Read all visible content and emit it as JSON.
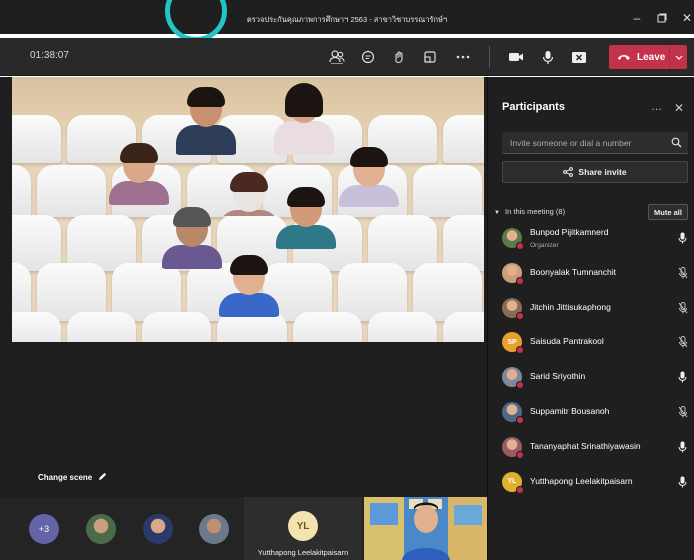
{
  "window": {
    "title": "ตรวจประกันคุณภาพการศึกษาฯ 2563 - สาขาวิชาบรรณารักษ์ฯ"
  },
  "toolbar": {
    "timer": "01:38:07",
    "leave_label": "Leave"
  },
  "stage": {
    "change_scene_label": "Change scene"
  },
  "strip": {
    "overflow_count": "+3",
    "tile_initials": "YL",
    "tile_name": "Yutthapong Leelakitpaisarn"
  },
  "panel": {
    "title": "Participants",
    "invite_placeholder": "Invite someone or dial a number",
    "share_invite_label": "Share invite",
    "section_label": "In this meeting (8)",
    "mute_all_label": "Mute all",
    "participants": [
      {
        "name": "Bunpod Pijitkamnerd",
        "role": "Organizer",
        "mic": "on",
        "avatar": "photo",
        "color": "#5a7a4a"
      },
      {
        "name": "Boonyalak Tumnanchit",
        "role": "",
        "mic": "off",
        "avatar": "photo",
        "color": "#c9a07a"
      },
      {
        "name": "Jitchin Jittisukaphong",
        "role": "",
        "mic": "off",
        "avatar": "photo",
        "color": "#8a6a50"
      },
      {
        "name": "Saisuda Pantrakool",
        "role": "",
        "mic": "off",
        "avatar": "initials",
        "initials": "SP",
        "color": "#e8a030"
      },
      {
        "name": "Sarid Sriyothin",
        "role": "",
        "mic": "on",
        "avatar": "photo",
        "color": "#7a8a9a"
      },
      {
        "name": "Suppamitr Bousanoh",
        "role": "",
        "mic": "off",
        "avatar": "photo",
        "color": "#4a6a8a"
      },
      {
        "name": "Tananyaphat Srinathiyawasin",
        "role": "",
        "mic": "on",
        "avatar": "photo",
        "color": "#9a5a6a"
      },
      {
        "name": "Yutthapong Leelakitpaisarn",
        "role": "",
        "mic": "on",
        "avatar": "initials",
        "initials": "YL",
        "color": "#e0b030"
      }
    ]
  },
  "colors": {
    "leave_red": "#c4314b",
    "accent_purple": "#6264a7",
    "ring_teal": "#22c4c4"
  }
}
